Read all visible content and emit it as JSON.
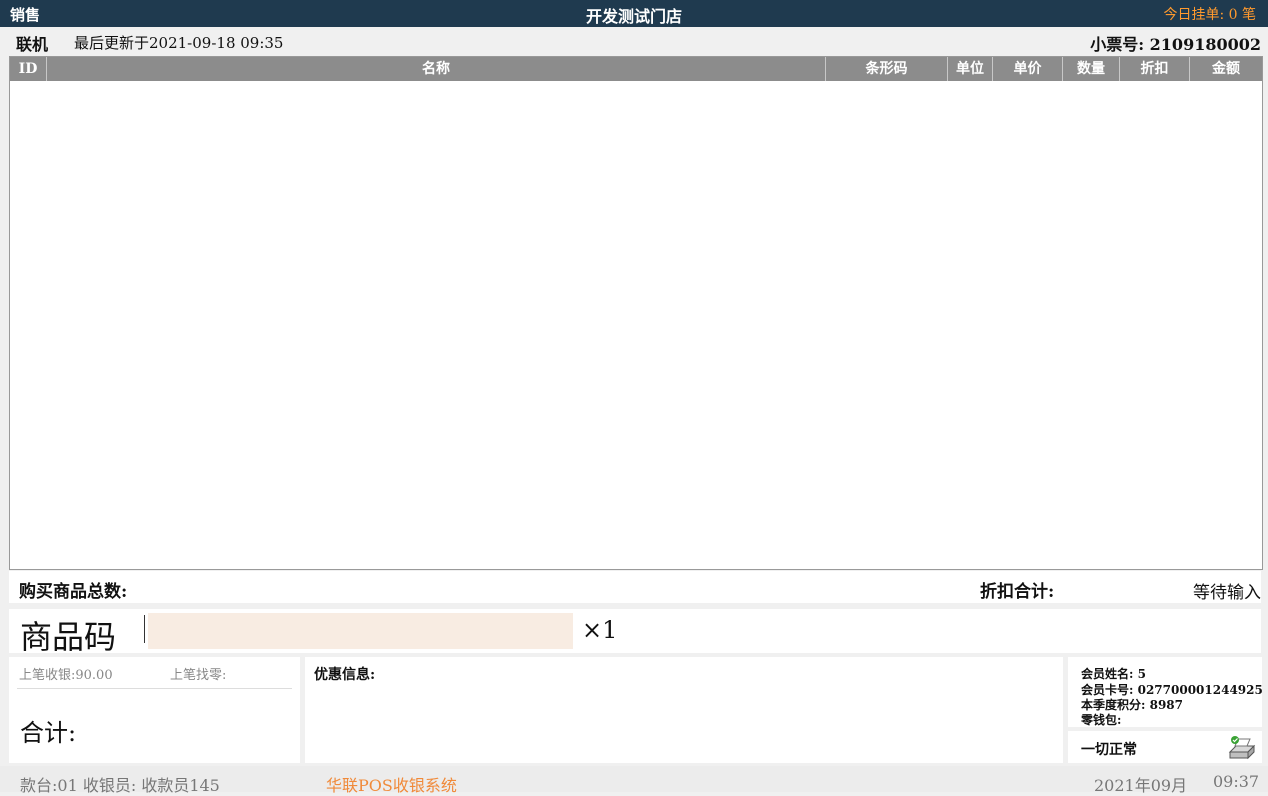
{
  "titlebar": {
    "mode": "销售",
    "store": "开发测试门店",
    "pending": "今日挂单: 0 笔"
  },
  "status": {
    "online": "联机",
    "updated": "最后更新于2021-09-18 09:35",
    "ticket": "小票号: 2109180002"
  },
  "table": {
    "columns": [
      "ID",
      "名称",
      "条形码",
      "单位",
      "单价",
      "数量",
      "折扣",
      "金额"
    ],
    "rows": []
  },
  "summary": {
    "count_label": "购买商品总数:",
    "discount_label": "折扣合计:",
    "waiting": "等待输入"
  },
  "input": {
    "label": "商品码",
    "value": "",
    "multiplier": "×1"
  },
  "last": {
    "paid": "上笔收银:90.00",
    "change": "上笔找零:",
    "total_label": "合计:"
  },
  "promo": {
    "label": "优惠信息:"
  },
  "member": {
    "name": "会员姓名: 5",
    "card": "会员卡号: 027700001244925",
    "points": "本季度积分:  8987",
    "wallet": "零钱包:"
  },
  "system_status": {
    "text": "一切正常",
    "icon": "printer-icon"
  },
  "footer": {
    "terminal": "款台:01  收银员: 收款员145",
    "brand": "华联POS收银系统",
    "date": "2021年09月",
    "time": "09:37"
  }
}
